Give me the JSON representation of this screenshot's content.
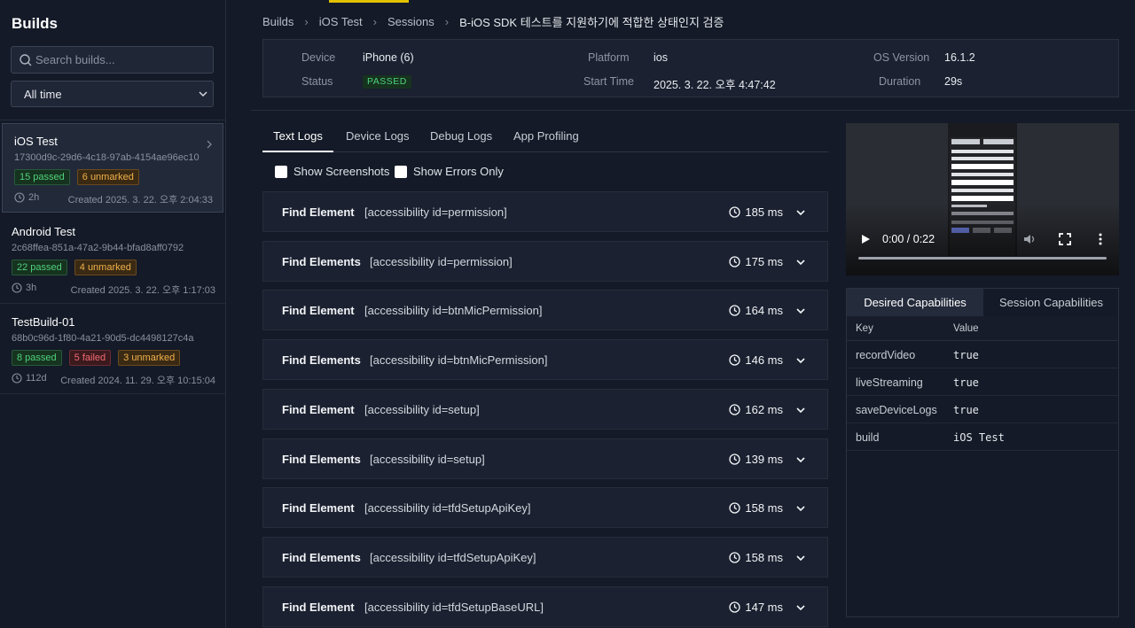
{
  "sidebar": {
    "title": "Builds",
    "search_placeholder": "Search builds...",
    "filter": "All time",
    "builds": [
      {
        "name": "iOS Test",
        "id": "17300d9c-29d6-4c18-97ab-4154ae96ec10",
        "passed": "15 passed",
        "failed": "",
        "unmarked": "6 unmarked",
        "age": "2h",
        "created": "Created 2025. 3. 22. 오후 2:04:33"
      },
      {
        "name": "Android Test",
        "id": "2c68ffea-851a-47a2-9b44-bfad8aff0792",
        "passed": "22 passed",
        "failed": "",
        "unmarked": "4 unmarked",
        "age": "3h",
        "created": "Created 2025. 3. 22. 오후 1:17:03"
      },
      {
        "name": "TestBuild-01",
        "id": "68b0c96d-1f80-4a21-90d5-dc4498127c4a",
        "passed": "8 passed",
        "failed": "5 failed",
        "unmarked": "3 unmarked",
        "age": "112d",
        "created": "Created 2024. 11. 29. 오후 10:15:04"
      }
    ]
  },
  "breadcrumb": {
    "items": [
      "Builds",
      "iOS Test",
      "Sessions"
    ],
    "current": "B-iOS SDK 테스트를 지원하기에 적합한 상태인지 검증"
  },
  "session": {
    "device_label": "Device",
    "device": "iPhone (6)",
    "platform_label": "Platform",
    "platform": "ios",
    "os_label": "OS Version",
    "os": "16.1.2",
    "status_label": "Status",
    "status": "PASSED",
    "start_label": "Start Time",
    "start": "2025. 3. 22. 오후 4:47:42",
    "duration_label": "Duration",
    "duration": "29s"
  },
  "tabs": [
    "Text Logs",
    "Device Logs",
    "Debug Logs",
    "App Profiling"
  ],
  "filters": {
    "screenshots": "Show Screenshots",
    "errors": "Show Errors Only"
  },
  "logs": [
    {
      "cmd": "Find Element",
      "selector": "[accessibility id=permission]",
      "ms": "185 ms"
    },
    {
      "cmd": "Find Elements",
      "selector": "[accessibility id=permission]",
      "ms": "175 ms"
    },
    {
      "cmd": "Find Element",
      "selector": "[accessibility id=btnMicPermission]",
      "ms": "164 ms"
    },
    {
      "cmd": "Find Elements",
      "selector": "[accessibility id=btnMicPermission]",
      "ms": "146 ms"
    },
    {
      "cmd": "Find Element",
      "selector": "[accessibility id=setup]",
      "ms": "162 ms"
    },
    {
      "cmd": "Find Elements",
      "selector": "[accessibility id=setup]",
      "ms": "139 ms"
    },
    {
      "cmd": "Find Element",
      "selector": "[accessibility id=tfdSetupApiKey]",
      "ms": "158 ms"
    },
    {
      "cmd": "Find Elements",
      "selector": "[accessibility id=tfdSetupApiKey]",
      "ms": "158 ms"
    },
    {
      "cmd": "Find Element",
      "selector": "[accessibility id=tfdSetupBaseURL]",
      "ms": "147 ms"
    }
  ],
  "video": {
    "time": "0:00 / 0:22",
    "progress": 0
  },
  "capabilities": {
    "tabs": [
      "Desired Capabilities",
      "Session Capabilities"
    ],
    "key_header": "Key",
    "value_header": "Value",
    "rows": [
      {
        "key": "recordVideo",
        "value": "true"
      },
      {
        "key": "liveStreaming",
        "value": "true"
      },
      {
        "key": "saveDeviceLogs",
        "value": "true"
      },
      {
        "key": "build",
        "value": "iOS Test"
      }
    ]
  }
}
